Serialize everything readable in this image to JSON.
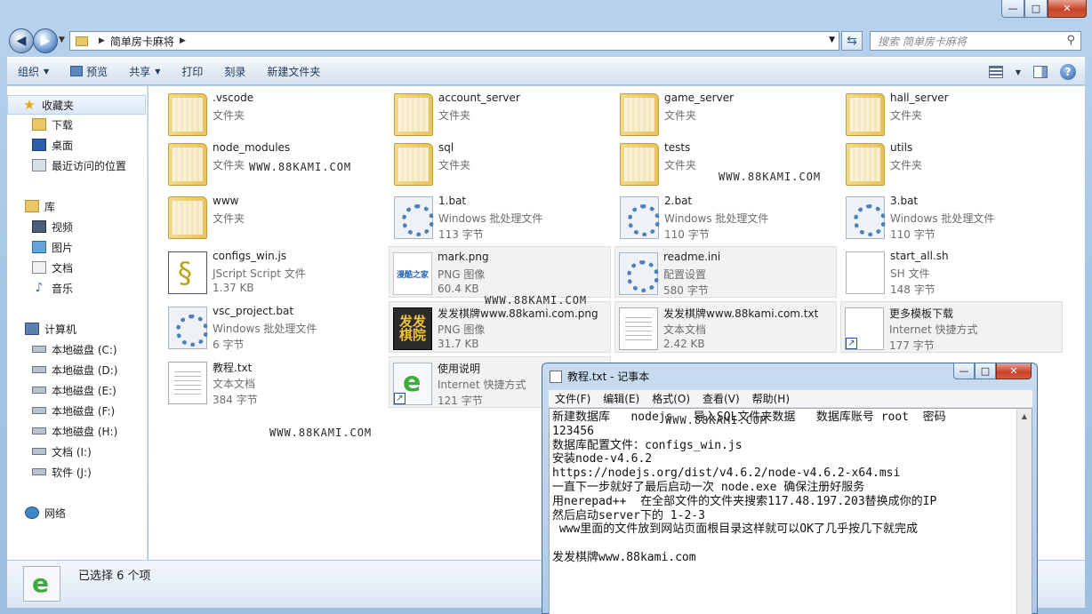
{
  "window": {
    "minimize": "—",
    "maximize": "□",
    "close": "✕"
  },
  "nav": {
    "breadcrumb": "简单房卡麻将",
    "search_placeholder": "搜索 简单房卡麻将"
  },
  "toolbar": {
    "organize": "组织",
    "preview": "预览",
    "share": "共享",
    "print": "打印",
    "burn": "刻录",
    "new_folder": "新建文件夹"
  },
  "sidebar": {
    "favorites": "收藏夹",
    "downloads": "下载",
    "desktop": "桌面",
    "recent": "最近访问的位置",
    "libraries": "库",
    "videos": "视频",
    "pictures": "图片",
    "documents": "文档",
    "music": "音乐",
    "computer": "计算机",
    "drive_c": "本地磁盘 (C:)",
    "drive_d": "本地磁盘 (D:)",
    "drive_e": "本地磁盘 (E:)",
    "drive_f": "本地磁盘 (F:)",
    "drive_h": "本地磁盘 (H:)",
    "drive_i": "文档 (I:)",
    "drive_j": "软件 (J:)",
    "network": "网络"
  },
  "files": [
    {
      "name": ".vscode",
      "type": "文件夹",
      "size": "",
      "icon": "folder-icon"
    },
    {
      "name": "account_server",
      "type": "文件夹",
      "size": "",
      "icon": "folder-icon"
    },
    {
      "name": "game_server",
      "type": "文件夹",
      "size": "",
      "icon": "folder-icon"
    },
    {
      "name": "hall_server",
      "type": "文件夹",
      "size": "",
      "icon": "folder-icon"
    },
    {
      "name": "node_modules",
      "type": "文件夹",
      "size": "",
      "icon": "folder-icon"
    },
    {
      "name": "sql",
      "type": "文件夹",
      "size": "",
      "icon": "folder-icon"
    },
    {
      "name": "tests",
      "type": "文件夹",
      "size": "",
      "icon": "folder-icon"
    },
    {
      "name": "utils",
      "type": "文件夹",
      "size": "",
      "icon": "folder-icon"
    },
    {
      "name": "www",
      "type": "文件夹",
      "size": "",
      "icon": "folder-icon"
    },
    {
      "name": "1.bat",
      "type": "Windows 批处理文件",
      "size": "113 字节",
      "icon": "batch-file-icon"
    },
    {
      "name": "2.bat",
      "type": "Windows 批处理文件",
      "size": "110 字节",
      "icon": "batch-file-icon"
    },
    {
      "name": "3.bat",
      "type": "Windows 批处理文件",
      "size": "110 字节",
      "icon": "batch-file-icon"
    },
    {
      "name": "configs_win.js",
      "type": "JScript Script 文件",
      "size": "1.37 KB",
      "icon": "jscript-file-icon"
    },
    {
      "name": "mark.png",
      "type": "PNG 图像",
      "size": "60.4 KB",
      "icon": "png-image-icon"
    },
    {
      "name": "readme.ini",
      "type": "配置设置",
      "size": "580 字节",
      "icon": "settings-file-icon"
    },
    {
      "name": "start_all.sh",
      "type": "SH 文件",
      "size": "148 字节",
      "icon": "blank-file-icon"
    },
    {
      "name": "vsc_project.bat",
      "type": "Windows 批处理文件",
      "size": "6 字节",
      "icon": "batch-file-icon"
    },
    {
      "name": "发发棋牌www.88kami.com.png",
      "type": "PNG 图像",
      "size": "31.7 KB",
      "icon": "png-image-icon"
    },
    {
      "name": "发发棋牌www.88kami.com.txt",
      "type": "文本文档",
      "size": "2.42 KB",
      "icon": "text-file-icon"
    },
    {
      "name": "更多模板下载",
      "type": "Internet 快捷方式",
      "size": "177 字节",
      "icon": "internet-shortcut-icon"
    },
    {
      "name": "教程.txt",
      "type": "文本文档",
      "size": "384 字节",
      "icon": "text-file-icon"
    },
    {
      "name": "使用说明",
      "type": "Internet 快捷方式",
      "size": "121 字节",
      "icon": "internet-shortcut-icon"
    }
  ],
  "icon_text": {
    "mark_png": "漫酷之家",
    "ff_png": "发发\n棋院",
    "shortcut_arrow": "↗"
  },
  "watermark": "WWW.88KAMI.COM",
  "details": {
    "selection": "已选择 6 个项"
  },
  "notepad": {
    "title": "教程.txt - 记事本",
    "menu_file": "文件(F)",
    "menu_edit": "编辑(E)",
    "menu_format": "格式(O)",
    "menu_view": "查看(V)",
    "menu_help": "帮助(H)",
    "content": "新建数据库   nodejs   导入SQL文件夹数据   数据库账号 root  密码\n123456\n数据库配置文件：configs_win.js\n安装node-v4.6.2\nhttps://nodejs.org/dist/v4.6.2/node-v4.6.2-x64.msi\n一直下一步就好了最后启动一次 node.exe 确保注册好服务\n用nerepad++  在全部文件的文件夹搜索117.48.197.203替换成你的IP\n然后启动server下的 1-2-3\n www里面的文件放到网站页面根目录这样就可以OK了几乎按几下就完成\n\n发发棋牌www.88kami.com"
  }
}
